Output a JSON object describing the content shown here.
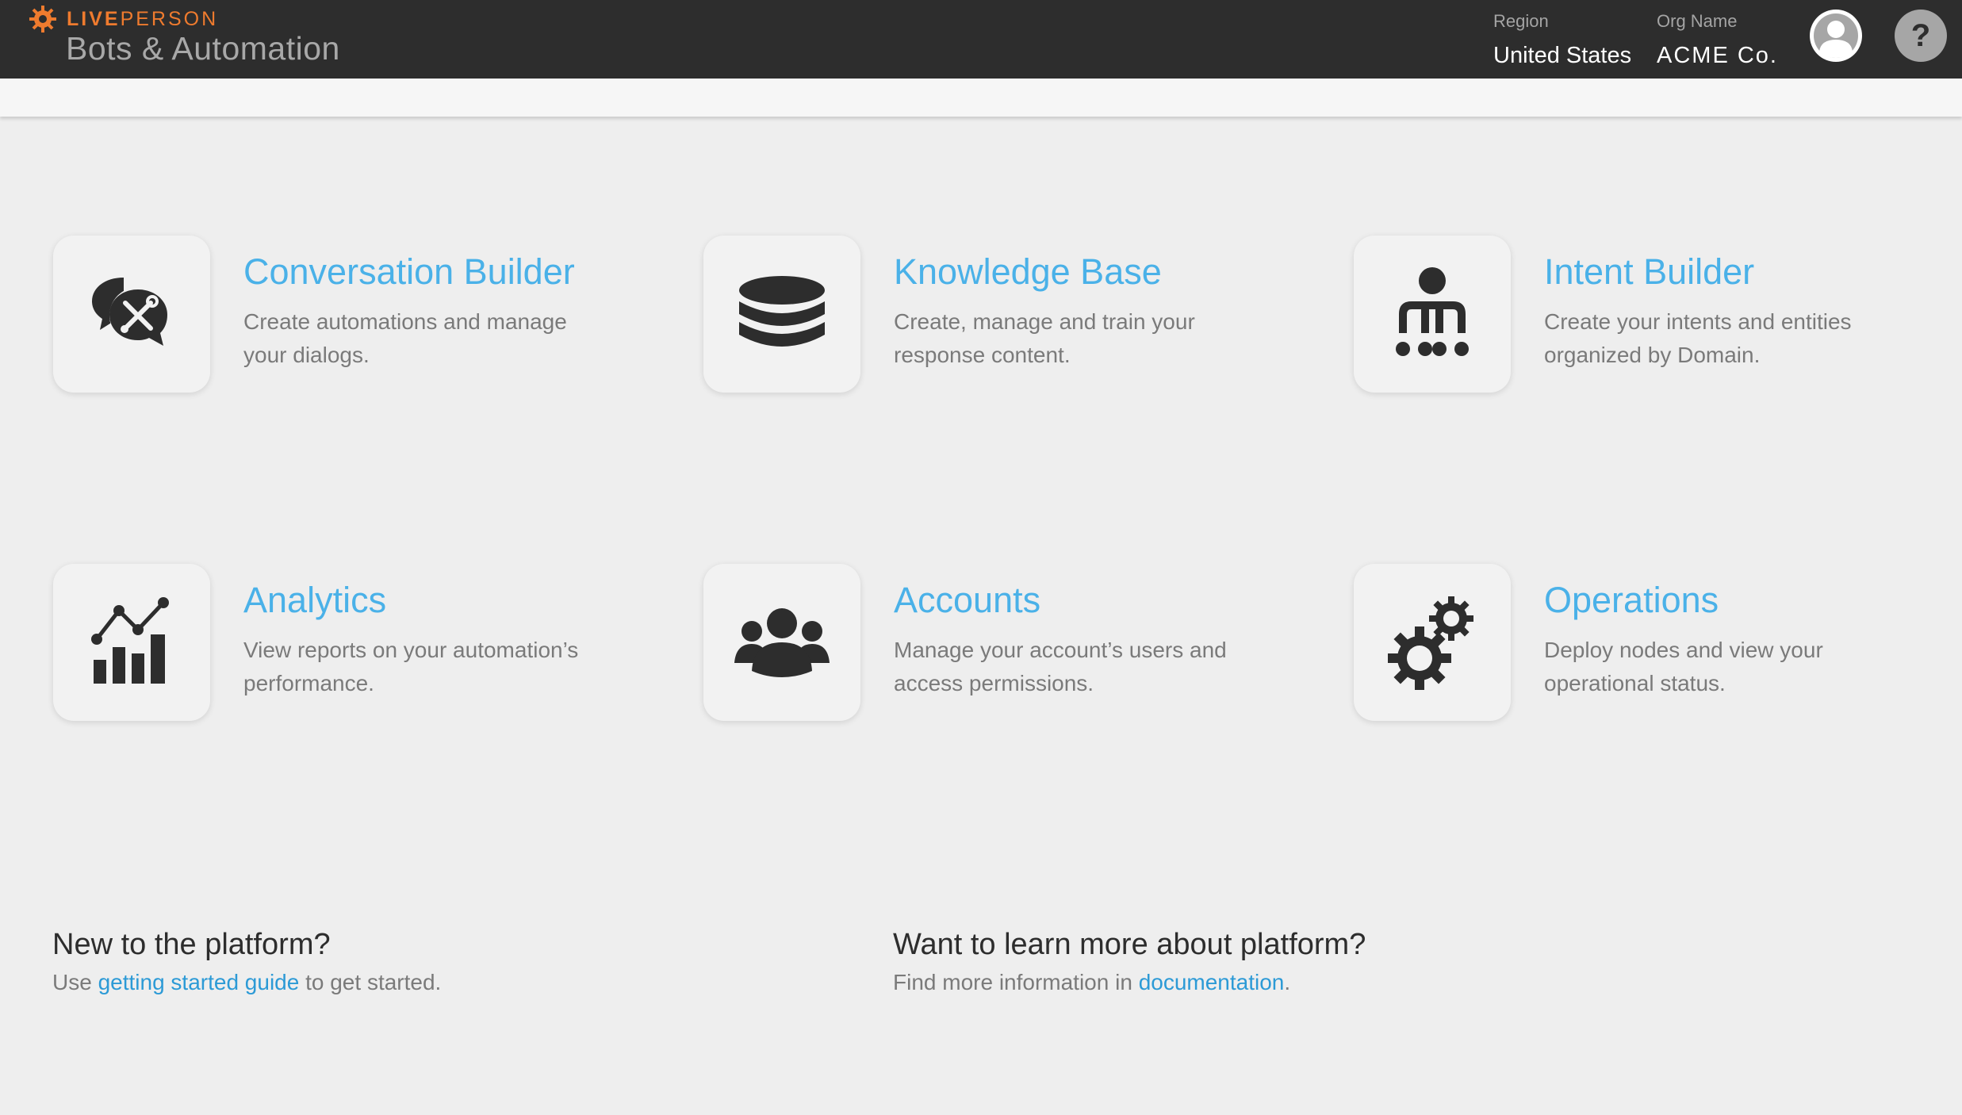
{
  "header": {
    "brand_bold": "LIVE",
    "brand_light": "PERSON",
    "app_title": "Bots & Automation",
    "region_label": "Region",
    "region_value": "United States",
    "org_label": "Org Name",
    "org_value": "ACME Co.",
    "help_glyph": "?"
  },
  "tiles": [
    {
      "title": "Conversation Builder",
      "desc": "Create automations and manage your dialogs.",
      "icon": "chat-tools-icon"
    },
    {
      "title": "Knowledge Base",
      "desc": "Create, manage and train your response content.",
      "icon": "database-icon"
    },
    {
      "title": "Intent Builder",
      "desc": "Create your intents and entities organized by Domain.",
      "icon": "hierarchy-icon"
    },
    {
      "title": "Analytics",
      "desc": "View reports on your automation’s performance.",
      "icon": "bar-line-chart-icon"
    },
    {
      "title": "Accounts",
      "desc": "Manage your account’s users and access permissions.",
      "icon": "users-icon"
    },
    {
      "title": "Operations",
      "desc": "Deploy nodes and view your operational status.",
      "icon": "gears-icon"
    }
  ],
  "footer": {
    "new_heading": "New to the platform?",
    "new_pre": "Use ",
    "new_link": "getting started guide",
    "new_post": " to get started.",
    "learn_heading": "Want to learn more about platform?",
    "learn_pre": "Find more information in ",
    "learn_link": "documentation",
    "learn_post": "."
  },
  "colors": {
    "header_bg": "#2d2d2d",
    "brand_orange": "#ef7b2e",
    "tile_title": "#4ab1e8",
    "link": "#2c9ad6",
    "page_bg": "#eeeeee"
  }
}
